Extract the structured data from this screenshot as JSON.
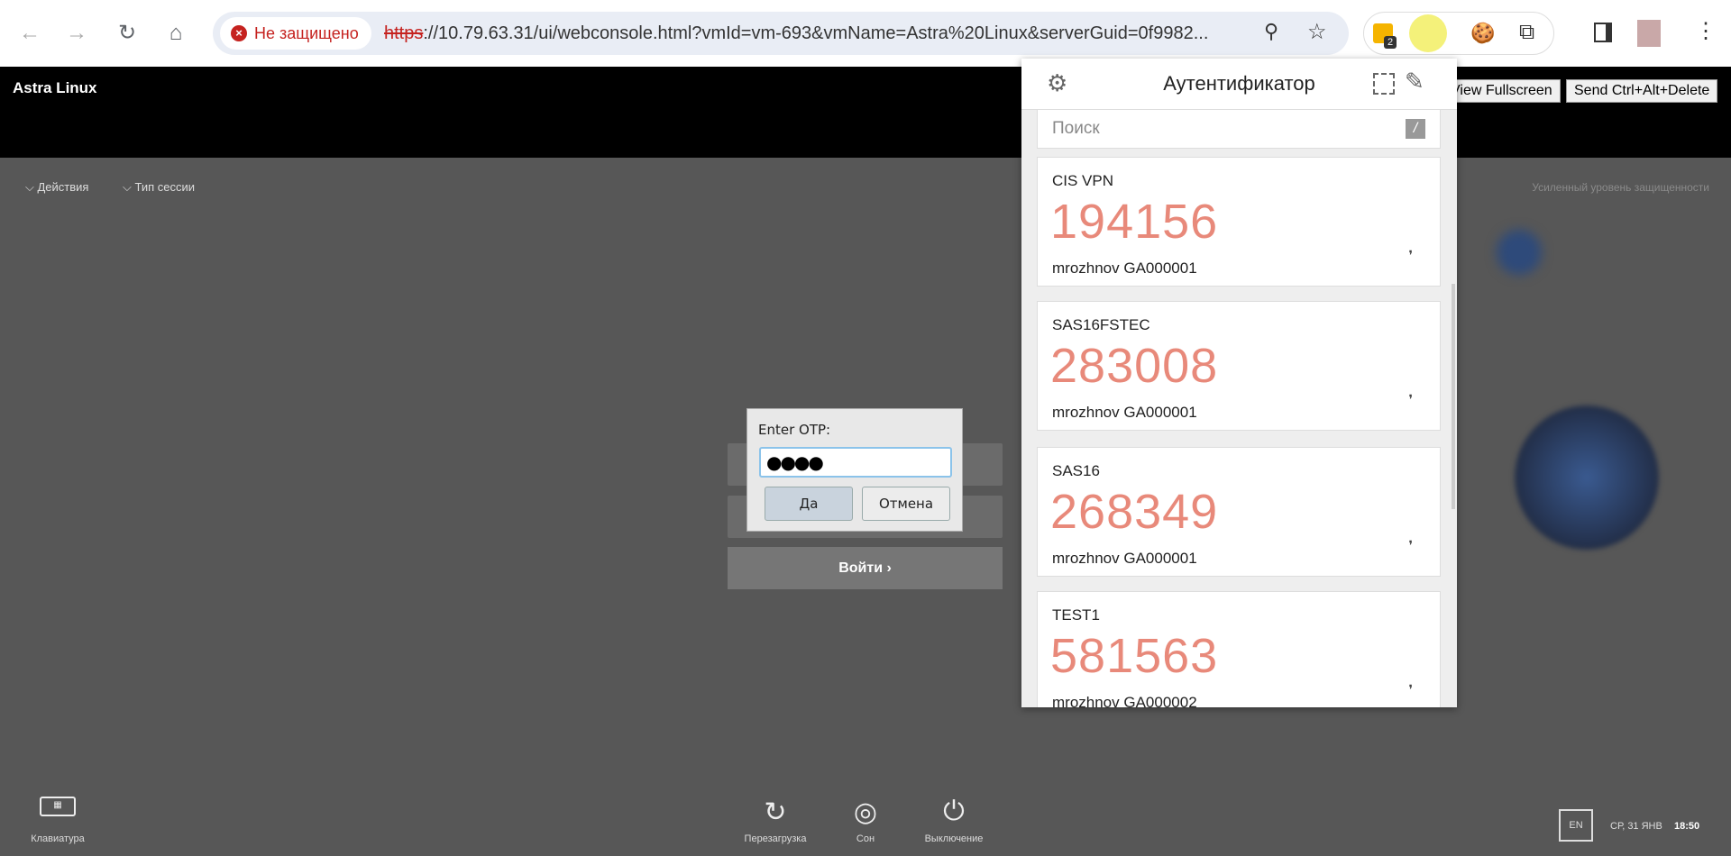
{
  "browser": {
    "security_label": "Не защищено",
    "url_scheme": "https",
    "url_rest": "://10.79.63.31/ui/webconsole.html?vmId=vm-693&vmName=Astra%20Linux&serverGuid=0f9982...",
    "ext_badge": "2"
  },
  "console": {
    "title": "Astra Linux",
    "view_fullscreen": "View Fullscreen",
    "send_cad": "Send Ctrl+Alt+Delete"
  },
  "vm": {
    "menu_actions": "Действия",
    "menu_session": "Тип сессии",
    "security_level": "Усиленный уровень защищенности",
    "login_button": "Войти",
    "bottom": {
      "keyboard": "Клавиатура",
      "restart": "Перезагрузка",
      "sleep": "Сон",
      "shutdown": "Выключение",
      "lang": "EN",
      "date": "СР, 31 ЯНВ",
      "time": "18:50"
    }
  },
  "otp_dialog": {
    "label": "Enter OTP:",
    "value": "●●●●",
    "ok": "Да",
    "cancel": "Отмена"
  },
  "authenticator": {
    "title": "Аутентификатор",
    "search_placeholder": "Поиск",
    "search_shortcut": "/",
    "entries": [
      {
        "issuer": "CIS VPN",
        "code": "194156",
        "account": "mrozhnov GA000001"
      },
      {
        "issuer": "SAS16FSTEC",
        "code": "283008",
        "account": "mrozhnov GA000001"
      },
      {
        "issuer": "SAS16",
        "code": "268349",
        "account": "mrozhnov GA000001"
      },
      {
        "issuer": "TEST1",
        "code": "581563",
        "account": "mrozhnov GA000002"
      }
    ]
  },
  "colors": {
    "otp_code": "#e8897a",
    "insecure": "#c5221f"
  }
}
